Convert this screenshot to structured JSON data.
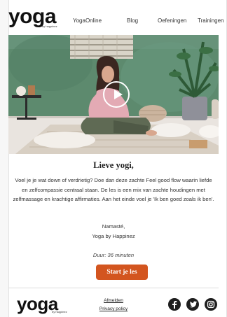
{
  "header": {
    "logo": "yoga",
    "logo_sub": "by happinez",
    "nav": [
      "YogaOnline",
      "Blog",
      "Oefeningen",
      "Trainingen"
    ]
  },
  "hero": {
    "play_icon": "play-icon"
  },
  "content": {
    "greeting": "Lieve yogi,",
    "intro": "Voel je je wat down of verdrietig? Doe dan deze zachte Feel good flow waarin liefde en zelfcompassie centraal staan. De les is een mix van zachte houdingen met zelfmassage en krachtige affirmaties. Aan het einde voel je 'Ik ben goed zoals ik ben'.",
    "signoff_1": "Namasté,",
    "signoff_2": "Yoga by Happinez",
    "duration": "Duur: 36 minuten",
    "cta": "Start je les"
  },
  "footer": {
    "logo": "yoga",
    "logo_sub": "by happinez",
    "links": [
      "Afmelden",
      "Privacy policy"
    ],
    "social": [
      "facebook-icon",
      "twitter-icon",
      "instagram-icon"
    ]
  },
  "colors": {
    "cta": "#d3551f",
    "wall": "#5d8a6e",
    "social": "#1e1e1e"
  }
}
